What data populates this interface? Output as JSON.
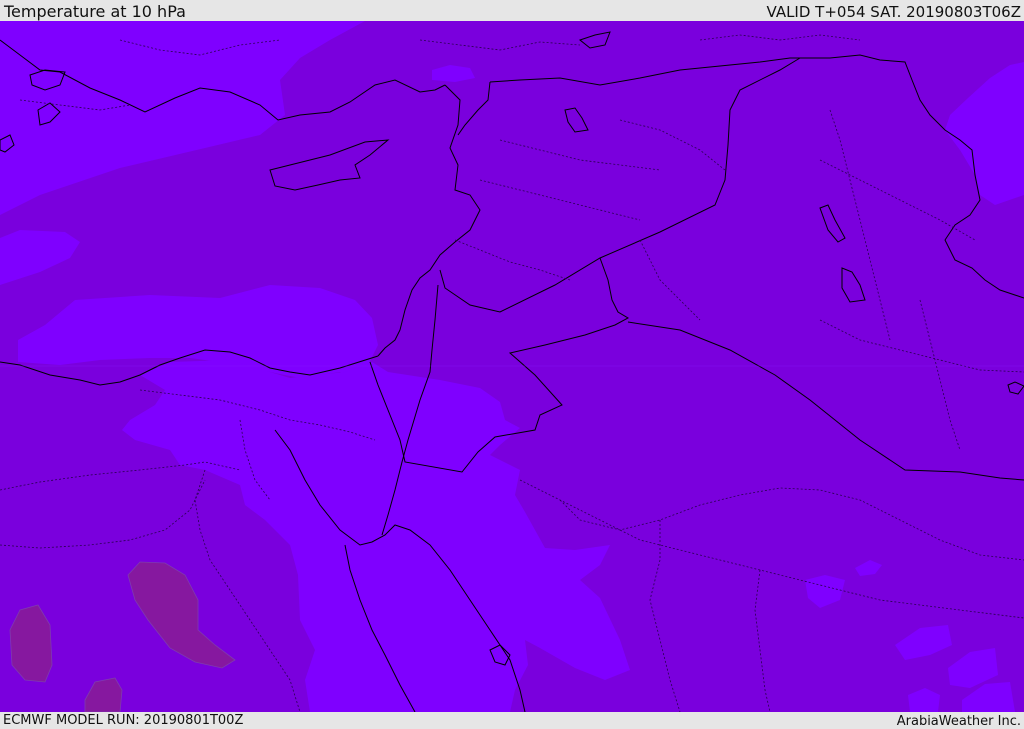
{
  "header": {
    "title": "Temperature at 10 hPa",
    "valid": "VALID T+054 SAT. 20190803T06Z"
  },
  "footer": {
    "model_run": "ECMWF MODEL RUN: 20190801T00Z",
    "credit": "ArabiaWeather Inc."
  },
  "colors": {
    "shade_dark": "#7a00dd",
    "shade_light": "#7f00ff",
    "shade_warm": "#86189f",
    "borders": "#000000"
  }
}
